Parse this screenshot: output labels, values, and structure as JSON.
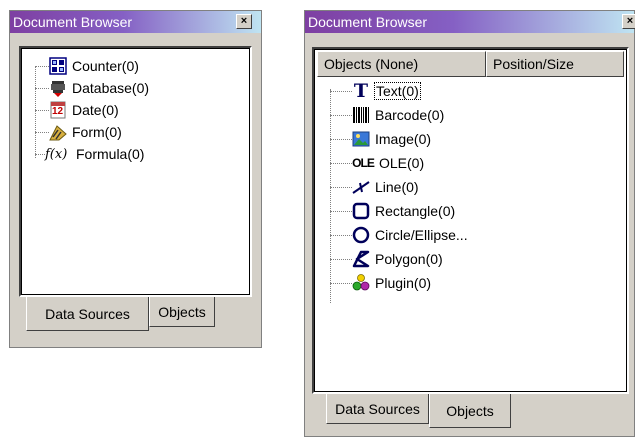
{
  "left_panel": {
    "title": "Document Browser",
    "close_glyph": "×",
    "tree_items": [
      {
        "label": "Counter(0)",
        "icon": "counter-icon"
      },
      {
        "label": "Database(0)",
        "icon": "database-icon"
      },
      {
        "label": "Date(0)",
        "icon": "date-icon"
      },
      {
        "label": "Form(0)",
        "icon": "form-icon"
      },
      {
        "label": "Formula(0)",
        "icon": "formula-icon"
      }
    ],
    "date_icon_text": "12",
    "formula_icon_text": "f(x)",
    "tabs": [
      {
        "label": "Data Sources",
        "active": true
      },
      {
        "label": "Objects",
        "active": false
      }
    ]
  },
  "right_panel": {
    "title": "Document Browser",
    "close_glyph": "×",
    "columns": [
      "Objects (None)",
      "Position/Size"
    ],
    "tree_items": [
      {
        "label": "Text(0)",
        "icon": "text-icon",
        "selected": true
      },
      {
        "label": "Barcode(0)",
        "icon": "barcode-icon"
      },
      {
        "label": "Image(0)",
        "icon": "image-icon"
      },
      {
        "label": "OLE(0)",
        "icon": "ole-icon"
      },
      {
        "label": "Line(0)",
        "icon": "line-icon"
      },
      {
        "label": "Rectangle(0)",
        "icon": "rectangle-icon"
      },
      {
        "label": "Circle/Ellipse...",
        "icon": "circle-icon"
      },
      {
        "label": "Polygon(0)",
        "icon": "polygon-icon"
      },
      {
        "label": "Plugin(0)",
        "icon": "plugin-icon"
      }
    ],
    "text_icon_text": "T",
    "ole_icon_text": "OLE",
    "tabs": [
      {
        "label": "Data Sources",
        "active": false
      },
      {
        "label": "Objects",
        "active": true
      }
    ]
  },
  "colors": {
    "title_start": "#7e3fa2",
    "title_end": "#bfe4f2",
    "dialog_face": "#d4d0c8"
  }
}
